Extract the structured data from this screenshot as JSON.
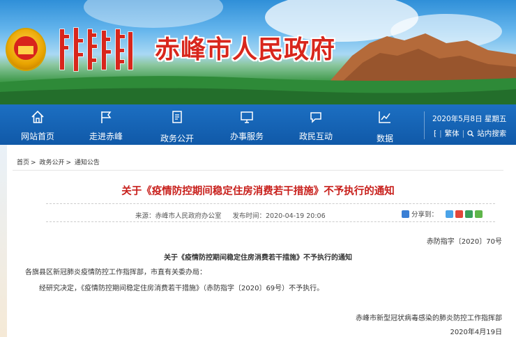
{
  "header": {
    "site_title": "赤峰市人民政府",
    "colors": {
      "title_red": "#d8261c",
      "nav_blue": "#1563b3"
    }
  },
  "nav": {
    "items": [
      {
        "label": "网站首页",
        "icon": "home-icon"
      },
      {
        "label": "走进赤峰",
        "icon": "flag-icon"
      },
      {
        "label": "政务公开",
        "icon": "document-icon"
      },
      {
        "label": "办事服务",
        "icon": "monitor-icon"
      },
      {
        "label": "政民互动",
        "icon": "chat-bubble-icon"
      },
      {
        "label": "数据",
        "icon": "line-chart-icon"
      }
    ],
    "date": "2020年5月8日 星期五",
    "traditional_label": "繁体",
    "search_label": "站内搜索"
  },
  "breadcrumb": {
    "items": [
      "首页",
      "政务公开",
      "通知公告"
    ],
    "separator": ">"
  },
  "article": {
    "title": "关于《疫情防控期间稳定住房消费若干措施》不予执行的通知",
    "source": "来源：赤峰市人民政府办公室",
    "publish_time": "发布时间：2020-04-19 20:06",
    "share_label": "分享到：",
    "doc_number": "赤防指字〔2020〕70号",
    "doc_heading": "关于《疫情防控期间稳定住房消费若干措施》不予执行的通知",
    "addressee": "各旗县区新冠肺炎疫情防控工作指挥部，市直有关委办局：",
    "body": "经研究决定，《疫情防控期间稳定住房消费若干措施》（赤防指字〔2020〕69号）不予执行。",
    "sign_org": "赤峰市新型冠状病毒感染的肺炎防控工作指挥部",
    "sign_date": "2020年4月19日"
  }
}
